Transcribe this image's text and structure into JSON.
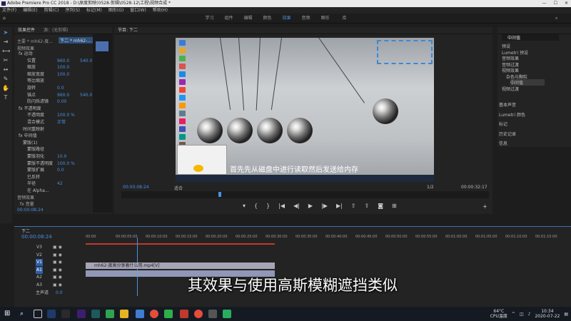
{
  "app": {
    "title": "Adobe Premiere Pro CC 2018 - D:\\原度剪映(0528-剪辑\\0528-12\\工程\\视频合成 *",
    "menu": [
      "文件(F)",
      "编辑(E)",
      "剪辑(C)",
      "序列(S)",
      "标记(M)",
      "图形(G)",
      "窗口(W)",
      "帮助(H)"
    ],
    "workspaces": [
      "学习",
      "组件",
      "编辑",
      "颜色",
      "效果",
      "音频",
      "图形",
      "库"
    ],
    "active_workspace": "效果"
  },
  "effect_controls": {
    "tab": "效果控件",
    "tab2": "源：(无剪辑)",
    "clip_label": "主要 * mh62-度...",
    "seq_label": "下二 * mh62-...",
    "section_video": "视频效果",
    "rows": [
      {
        "label": "fx  运动"
      },
      {
        "label": "位置",
        "v1": "960.0",
        "v2": "540.0"
      },
      {
        "label": "缩放",
        "v1": "100.0"
      },
      {
        "label": "缩放宽度",
        "v1": "100.0"
      },
      {
        "label": "等比缩放"
      },
      {
        "label": "旋转",
        "v1": "0.0"
      },
      {
        "label": "锚点",
        "v1": "960.0",
        "v2": "540.0"
      },
      {
        "label": "防闪烁滤镜",
        "v1": "0.00"
      },
      {
        "label": "fx  不透明度"
      },
      {
        "label": "不透明度",
        "v1": "100.0 %"
      },
      {
        "label": "混合模式",
        "v1": "正常"
      },
      {
        "label": "时间重映射"
      },
      {
        "label": "fx  中间值"
      },
      {
        "label": "蒙版(1)"
      },
      {
        "label": "蒙版路径"
      },
      {
        "label": "蒙版羽化",
        "v1": "10.0"
      },
      {
        "label": "蒙版不透明度",
        "v1": "100.0 %"
      },
      {
        "label": "蒙版扩展",
        "v1": "0.0"
      },
      {
        "label": "已反转"
      },
      {
        "label": "半径",
        "v1": "42"
      },
      {
        "label": "在 Alpha..."
      }
    ],
    "audio_label": "音频效果",
    "volume_label": "fx  音量",
    "timecode": "00:00:08:24"
  },
  "program_monitor": {
    "tab": "节目: 下二",
    "subtitle": "首先先从磁盘中进行读取然后发送给内存",
    "timecode_left": "00:00:08:24",
    "fit": "适合",
    "scale": "1/2",
    "timecode_right": "00:00:32:17"
  },
  "project": {
    "tab": "中间值",
    "items": [
      "预设",
      "Lumetri 预设",
      "音频效果",
      "音频过渡",
      "视频效果",
      "杂色与颗粒",
      "中间值",
      "视频过渡"
    ],
    "right_list": [
      "基本声音",
      "Lumetri 颜色",
      "标记",
      "历史记录",
      "信息"
    ]
  },
  "timeline": {
    "tab": "下二",
    "timecode": "00:00:08:24",
    "ruler": [
      "00:00",
      "00:00:05:00",
      "00:00:10:00",
      "00:00:15:00",
      "00:00:20:00",
      "00:00:25:00",
      "00:00:30:00",
      "00:00:35:00",
      "00:00:40:00",
      "00:00:45:00",
      "00:00:50:00",
      "00:00:55:00",
      "00:01:00:00",
      "00:01:05:00",
      "00:01:10:00",
      "00:01:15:00"
    ],
    "tracks": [
      "V3",
      "V2",
      "V1",
      "A1",
      "A2",
      "A3"
    ],
    "master": "主声道",
    "master_val": "0.0",
    "clip_name": "mh62-度高分享着什么用.mp4[V]",
    "caption": "其效果与使用高斯模糊遮挡类似"
  },
  "taskbar": {
    "weather": "64°C",
    "weather2": "CPU温度",
    "time": "10:34",
    "date": "2020-07-22"
  }
}
